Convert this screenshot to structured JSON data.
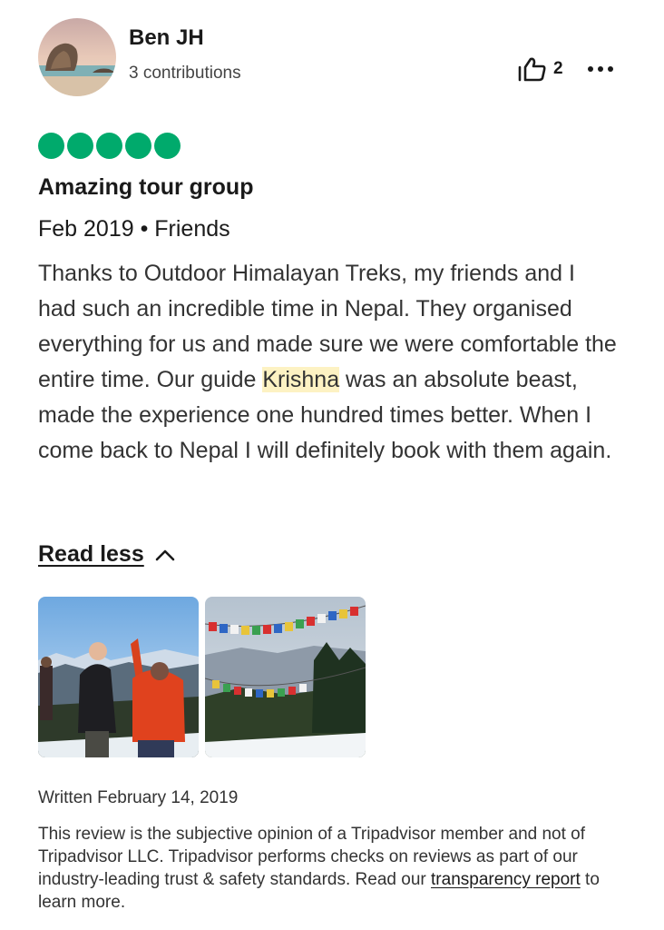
{
  "review": {
    "author": {
      "name": "Ben JH",
      "contributions": "3 contributions"
    },
    "helpful_votes": "2",
    "rating": {
      "bubbles": 5,
      "max": 5,
      "color": "#00aa6c"
    },
    "title": "Amazing tour group",
    "meta": "Feb 2019 • Friends",
    "body": {
      "part1": "Thanks to Outdoor Himalayan Treks, my friends and I had such an incredible time in Nepal. They organised everything for us and made sure we were comfortable the entire time. Our guide ",
      "highlight": "Krishna",
      "part2": " was an absolute beast, made the experience one hundred times better. When I come back to Nepal I will definitely book with them again."
    },
    "read_less_label": "Read less",
    "written_date": "Written February 14, 2019",
    "disclaimer": {
      "text": "This review is the subjective opinion of a Tripadvisor member and not of Tripadvisor LLC. Tripadvisor performs checks on reviews as part of our industry-leading trust & safety standards. Read our ",
      "link_text": "transparency report",
      "suffix": " to learn more."
    }
  },
  "icons": {
    "helpful": "thumbs-up-icon",
    "more": "more-dots-icon",
    "collapse": "chevron-up-icon"
  },
  "colors": {
    "accent": "#00aa6c",
    "highlight": "#fdf2c3"
  }
}
